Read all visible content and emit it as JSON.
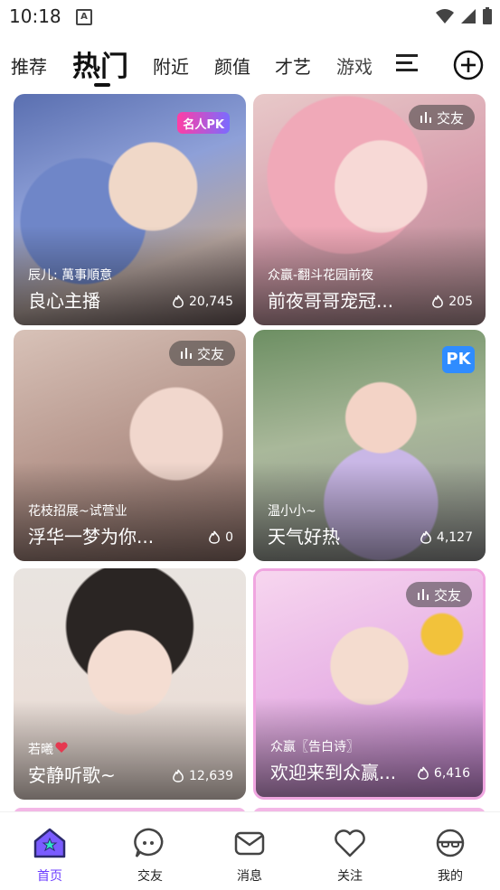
{
  "status_bar": {
    "time": "10:18",
    "notif_letter": "A"
  },
  "tabs": [
    "推荐",
    "热门",
    "附近",
    "颜值",
    "才艺",
    "游戏"
  ],
  "cards": [
    {
      "sub": "辰儿: 萬事順意",
      "title": "良心主播",
      "count": "20,745",
      "badge": "名人PK"
    },
    {
      "sub": "众赢-翻斗花园前夜",
      "title": "前夜哥哥宠冠...",
      "count": "205",
      "badge": "交友"
    },
    {
      "sub": "花枝招展~试营业",
      "title": "浮华一梦为你...",
      "count": "0",
      "badge": "交友"
    },
    {
      "sub": "温小小~",
      "title": "天气好热",
      "count": "4,127",
      "badge": "PK"
    },
    {
      "sub": "若曦",
      "title": "安静听歌~",
      "count": "12,639",
      "badge": ""
    },
    {
      "sub": "众赢〖告白诗〗",
      "title": "欢迎来到众赢...",
      "count": "6,416",
      "badge": "交友"
    }
  ],
  "bottom_nav": [
    {
      "label": "首页"
    },
    {
      "label": "交友"
    },
    {
      "label": "消息"
    },
    {
      "label": "关注"
    },
    {
      "label": "我的"
    }
  ],
  "colors": {
    "accent": "#6b3cff",
    "pk_badge": "#2f8cff"
  }
}
